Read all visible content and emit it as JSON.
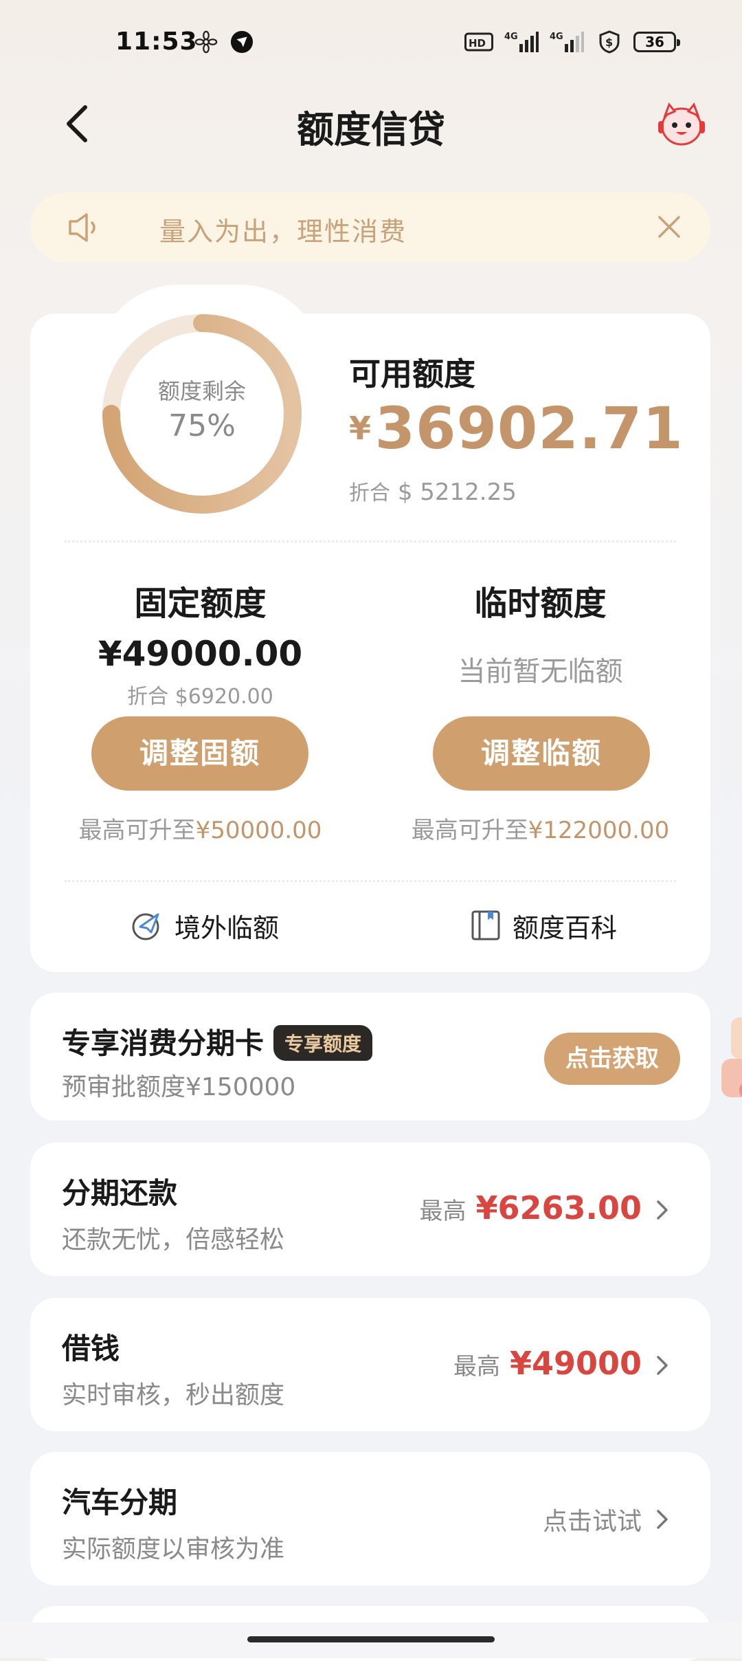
{
  "status_bar": {
    "time": "11:53",
    "battery": "36"
  },
  "header": {
    "title": "额度信贷"
  },
  "notice": {
    "text": "量入为出，理性消费"
  },
  "credit": {
    "gauge_label": "额度剩余",
    "gauge_percent": "75%",
    "gauge_fraction": 0.75,
    "available_label": "可用额度",
    "currency": "¥",
    "available_amount": "36902.71",
    "converted_prefix": "折合",
    "converted_amount": "$ 5212.25"
  },
  "fixed": {
    "title": "固定额度",
    "amount": "¥49000.00",
    "converted": "折合 $6920.00",
    "button": "调整固额",
    "limit_prefix": "最高可升至",
    "limit_value": "¥50000.00"
  },
  "temporary": {
    "title": "临时额度",
    "status": "当前暂无临额",
    "button": "调整临额",
    "limit_prefix": "最高可升至",
    "limit_value": "¥122000.00"
  },
  "links": {
    "overseas": "境外临额",
    "encyclopedia": "额度百科"
  },
  "installment_card": {
    "title": "专享消费分期卡",
    "badge": "专享额度",
    "subtitle": "预审批额度¥150000",
    "button": "点击获取"
  },
  "items": [
    {
      "title": "分期还款",
      "subtitle": "还款无忧，倍感轻松",
      "prefix": "最高",
      "amount": "¥6263.00"
    },
    {
      "title": "借钱",
      "subtitle": "实时审核，秒出额度",
      "prefix": "最高",
      "amount": "¥49000"
    },
    {
      "title": "汽车分期",
      "subtitle": "实际额度以审核为准",
      "action": "点击试试"
    }
  ],
  "colors": {
    "accent": "#cfa06e",
    "amount_red": "#d9453f",
    "gauge_track": "#f3e7db"
  }
}
